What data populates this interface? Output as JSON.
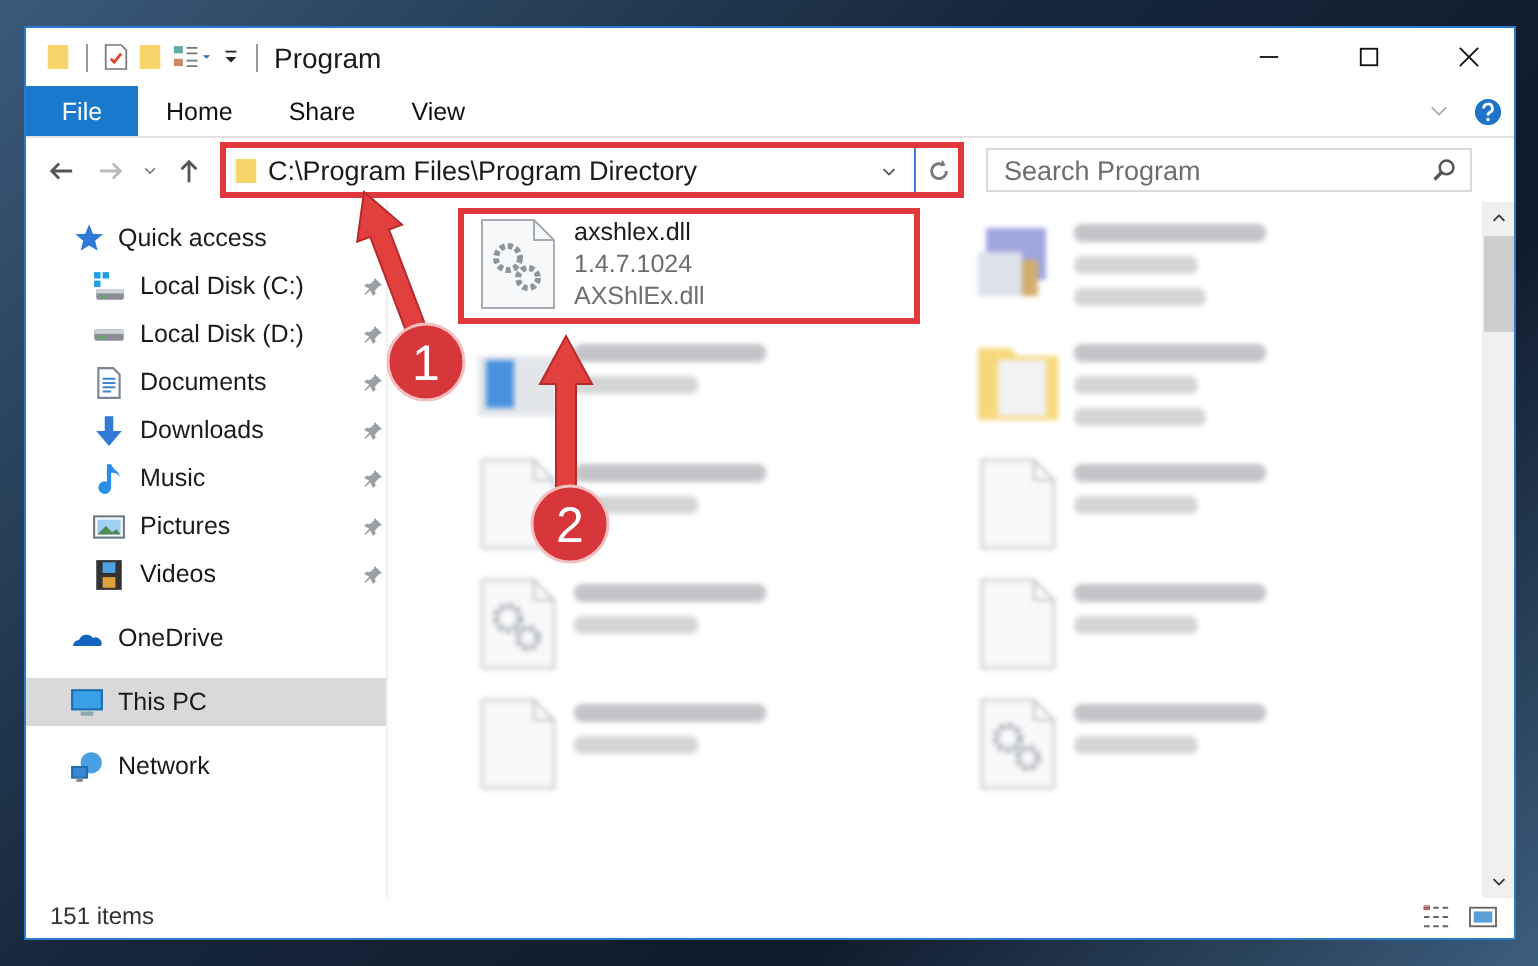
{
  "window": {
    "title": "Program"
  },
  "ribbon": {
    "file_menu": "File",
    "tabs": [
      {
        "label": "Home",
        "selected": false
      },
      {
        "label": "Share",
        "selected": false
      },
      {
        "label": "View",
        "selected": false
      }
    ]
  },
  "address": {
    "path": "C:\\Program Files\\Program Directory",
    "highlighted": true
  },
  "search": {
    "placeholder": "Search Program"
  },
  "sidebar": [
    {
      "label": "Quick access",
      "kind": "star",
      "selected": false,
      "children": [
        {
          "label": "Local Disk (C:)",
          "kind": "windrive",
          "pinned": true,
          "selected": false
        },
        {
          "label": "Local Disk (D:)",
          "kind": "drive",
          "pinned": true,
          "selected": false
        },
        {
          "label": "Documents",
          "kind": "document",
          "pinned": true,
          "selected": false
        },
        {
          "label": "Downloads",
          "kind": "download",
          "pinned": true,
          "selected": false
        },
        {
          "label": "Music",
          "kind": "music",
          "pinned": true,
          "selected": false
        },
        {
          "label": "Pictures",
          "kind": "picture",
          "pinned": true,
          "selected": false
        },
        {
          "label": "Videos",
          "kind": "video",
          "pinned": true,
          "selected": false
        }
      ]
    },
    {
      "label": "OneDrive",
      "kind": "cloud",
      "selected": false
    },
    {
      "label": "This PC",
      "kind": "computer",
      "selected": true
    },
    {
      "label": "Network",
      "kind": "network",
      "selected": false
    }
  ],
  "files": [
    {
      "name": "axshlex.dll",
      "lines": [
        "1.4.7.1024",
        "AXShlEx.dll"
      ],
      "kind": "dll",
      "highlighted": true,
      "blurred": false
    },
    {
      "kind": "exe",
      "highlighted": false,
      "blurred": true
    },
    {
      "kind": "installer",
      "highlighted": false,
      "blurred": true
    },
    {
      "kind": "folder",
      "highlighted": false,
      "blurred": true
    },
    {
      "kind": "file",
      "highlighted": false,
      "blurred": true
    },
    {
      "kind": "file",
      "highlighted": false,
      "blurred": true
    },
    {
      "kind": "dll",
      "highlighted": false,
      "blurred": true
    },
    {
      "kind": "file",
      "highlighted": false,
      "blurred": true
    },
    {
      "kind": "file",
      "highlighted": false,
      "blurred": true
    },
    {
      "kind": "dll",
      "highlighted": false,
      "blurred": true
    }
  ],
  "status_bar": {
    "count": "151 items"
  },
  "annotations": [
    {
      "number": "1",
      "kind": "diagonal"
    },
    {
      "number": "2",
      "kind": "vertical"
    }
  ]
}
